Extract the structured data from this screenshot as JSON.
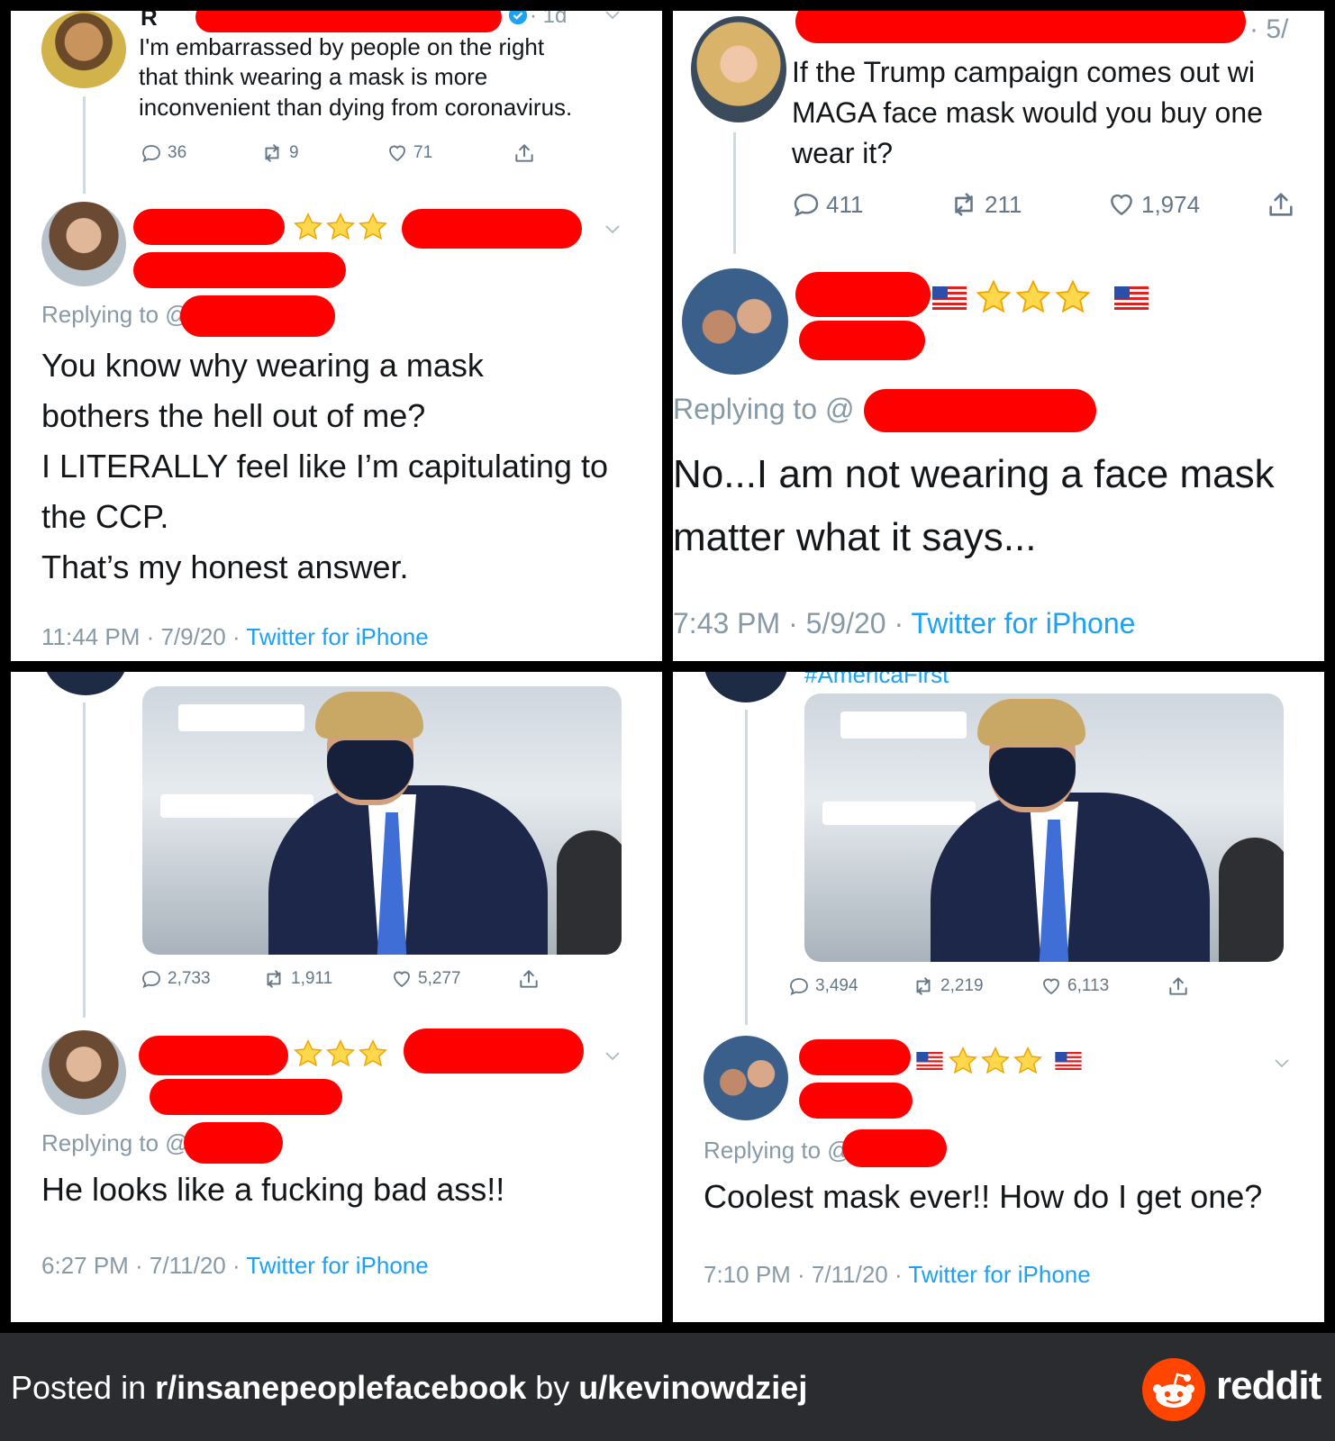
{
  "panels": [
    {
      "original": {
        "text": "I'm embarrassed by people on the right that think wearing a mask is more inconvenient than dying from coronavirus.",
        "line1": "I'm embarrassed by people on the right",
        "line2": "that think wearing a mask is more",
        "line3": "inconvenient than dying from coronavirus.",
        "name_fragment": "R",
        "age": "· 1d",
        "replies": "36",
        "retweets": "9",
        "likes": "71"
      },
      "reply": {
        "replying_to": "Replying to @",
        "line1": "You know why wearing a mask",
        "line2": "bothers the hell out of me?",
        "line3": "I LITERALLY feel like I’m capitulating to",
        "line4": "the CCP.",
        "line5": "That’s my honest answer.",
        "time": "11:44 PM · 7/9/20 · ",
        "source": "Twitter for iPhone"
      }
    },
    {
      "original": {
        "line1": "If the Trump campaign comes out wi",
        "line2": "MAGA face mask would you buy one",
        "line3": "wear it?",
        "age": "· 5/",
        "replies": "411",
        "retweets": "211",
        "likes": "1,974"
      },
      "reply": {
        "replying_to": "Replying to @",
        "line1": "No...I am not wearing a face mask",
        "line2": "matter what it says...",
        "time": "7:43 PM · 5/9/20 · ",
        "source": "Twitter for iPhone"
      }
    },
    {
      "original": {
        "replies": "2,733",
        "retweets": "1,911",
        "likes": "5,277"
      },
      "reply": {
        "replying_to": "Replying to @",
        "line1": "He looks like a fucking bad ass!!",
        "time": "6:27 PM · 7/11/20 · ",
        "source": "Twitter for iPhone"
      }
    },
    {
      "original": {
        "hashtag": "#AmericaFirst",
        "replies": "3,494",
        "retweets": "2,219",
        "likes": "6,113"
      },
      "reply": {
        "replying_to": "Replying to @",
        "line1": "Coolest mask ever!! How do I get one?",
        "time": "7:10 PM · 7/11/20 · ",
        "source": "Twitter for iPhone"
      }
    }
  ],
  "footer": {
    "prefix": "Posted in ",
    "subreddit": "r/insanepeoplefacebook",
    "middle": " by ",
    "user": "u/kevinowdziej",
    "brand": "reddit"
  },
  "colors": {
    "link": "#1da1f2",
    "muted": "#8899a6",
    "redaction": "#ff0000",
    "footer_bg": "#2b2c30",
    "reddit_orange": "#ff4500"
  },
  "icons": [
    "reply-icon",
    "retweet-icon",
    "like-icon",
    "share-icon",
    "verified-icon",
    "chevron-down-icon",
    "us-flag-icon",
    "star-icon",
    "reddit-logo-icon"
  ]
}
